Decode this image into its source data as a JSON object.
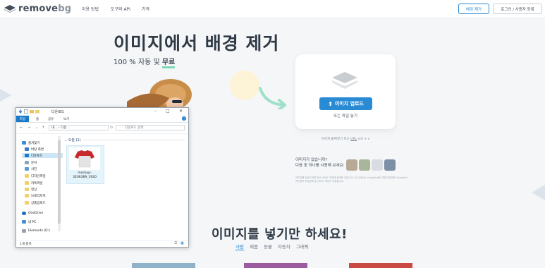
{
  "nav": {
    "brand": "remove",
    "brand_suffix": "bg",
    "links": [
      "이용 방법",
      "도구와 API",
      "가격"
    ],
    "upload_button": "배경 제거",
    "login_button": "로그인 / 사용자 등록"
  },
  "hero": {
    "title": "이미지에서 배경 제거",
    "subtitle": "100 % 자동 및",
    "subtitle_free": "무료"
  },
  "upload": {
    "button": "이미지 업로드",
    "drop": "또는 파일 놓기",
    "paste": "이미지 붙여넣기 또는",
    "paste_url": "URL",
    "paste_keys": "ctrl + v"
  },
  "samples": {
    "line1": "이미지가 없습니까?",
    "line2": "다음 중 하나를 사용해 보세요:"
  },
  "terms": "이미지를 업로드하면 당사 서비스 약관에 동의한 것입니다. 이 사이트는 hCaptcha에 의해 보호되며 hCaptcha 개인정보 보호정책 및 서비스 약관이 적용됩니다.",
  "section": {
    "title": "이미지를 넣기만 하세요!",
    "tabs": [
      "사람",
      "제품",
      "동물",
      "자동차",
      "그래픽"
    ]
  },
  "explorer": {
    "title": "다운로드",
    "ribbon": [
      "파일",
      "홈",
      "공유",
      "보기"
    ],
    "address": "내... › 다운...",
    "search_placeholder": "다운로드 검색",
    "nav_items": [
      {
        "label": "즐겨찾기"
      },
      {
        "label": "바탕 화면"
      },
      {
        "label": "다운로드"
      },
      {
        "label": "문서"
      },
      {
        "label": "사진"
      },
      {
        "label": "디자인파일"
      },
      {
        "label": "카톡파일"
      },
      {
        "label": "영상"
      },
      {
        "label": "브로티지저"
      },
      {
        "label": "상품업로드"
      },
      {
        "label": "OneDrive"
      },
      {
        "label": "내 PC"
      },
      {
        "label": "Elements (D:)"
      }
    ],
    "group": "오늘 (1)",
    "file_name": "mockup-3206369_1920",
    "status": "1개 항목"
  },
  "colors": {
    "accent": "#2a8bd5",
    "underline": "#7fd9b6",
    "explorer_blue": "#1979ca"
  }
}
